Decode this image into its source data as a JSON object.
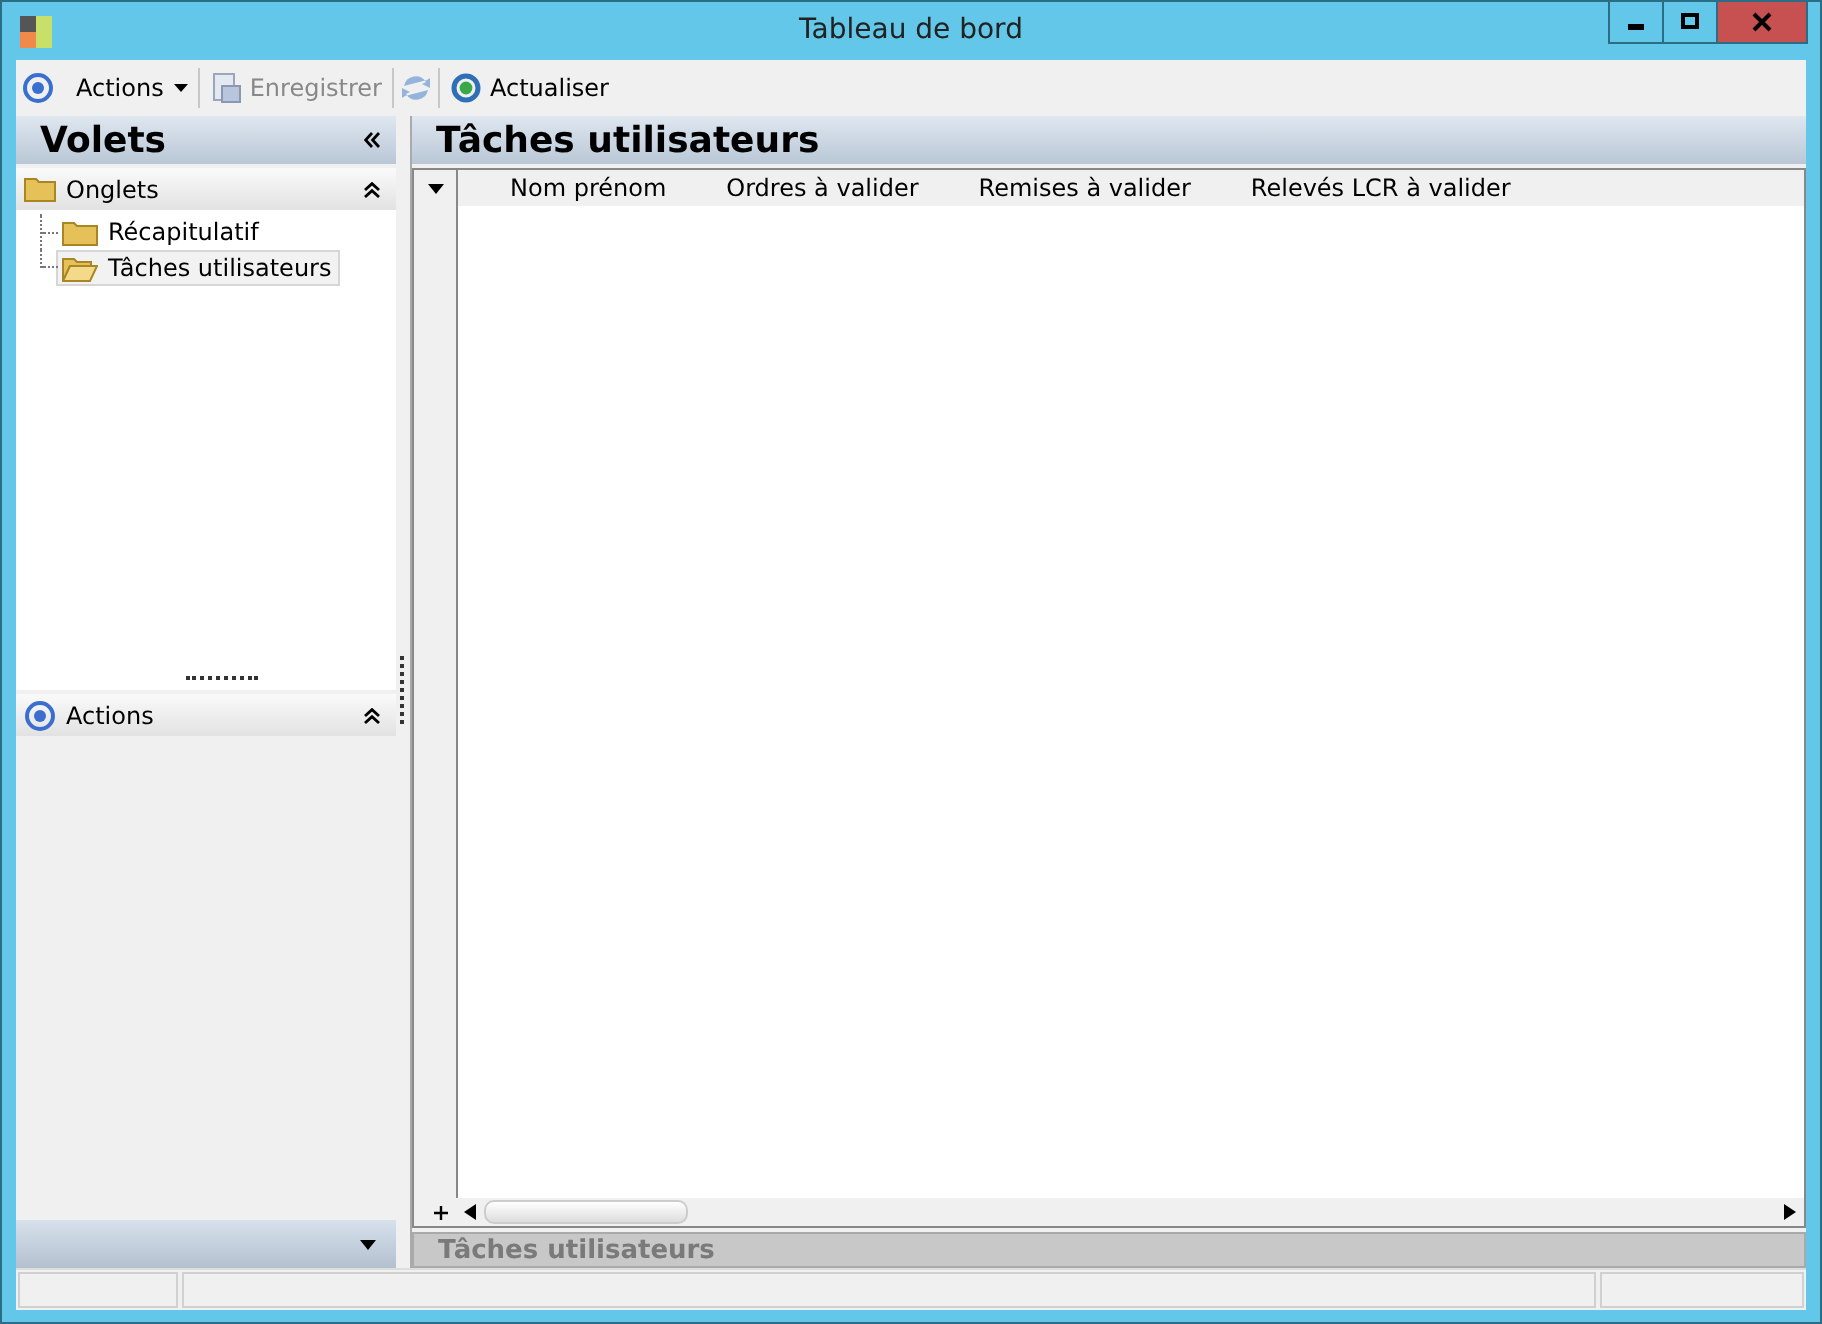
{
  "window": {
    "title": "Tableau de bord"
  },
  "toolbar": [
    {
      "kind": "menu",
      "label": "Actions",
      "disabled": false
    },
    {
      "kind": "button",
      "label": "Enregistrer",
      "disabled": true
    },
    {
      "kind": "icon",
      "disabled": true
    },
    {
      "kind": "button",
      "label": "Actualiser",
      "disabled": false
    }
  ],
  "sidebar": {
    "title": "Volets",
    "sections": [
      {
        "title": "Onglets",
        "kind": "folder",
        "items": [
          {
            "label": "Récapitulatif",
            "selected": false
          },
          {
            "label": "Tâches utilisateurs",
            "selected": true
          }
        ]
      },
      {
        "title": "Actions",
        "kind": "actions"
      }
    ]
  },
  "main": {
    "title": "Tâches utilisateurs",
    "columns": [
      "Nom prénom",
      "Ordres à valider",
      "Remises à valider",
      "Relevés LCR à valider"
    ],
    "footer_title": "Tâches utilisateurs"
  }
}
